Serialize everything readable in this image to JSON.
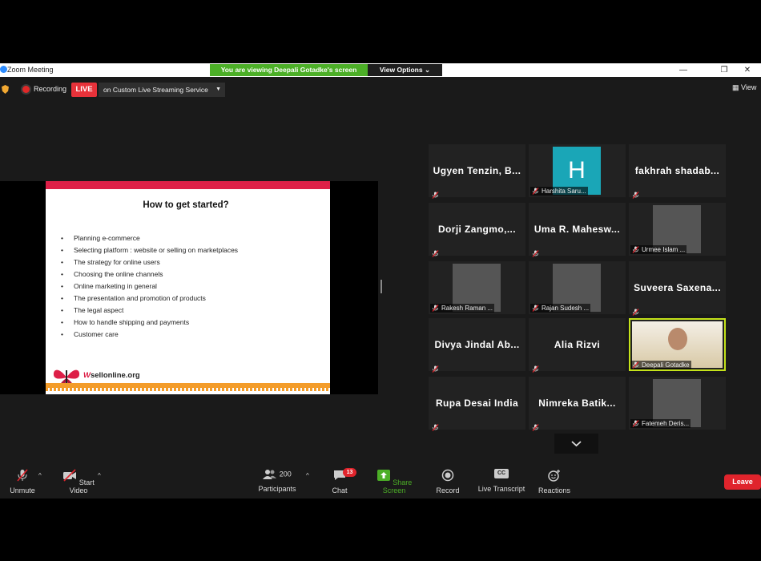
{
  "window": {
    "title": "Zoom Meeting",
    "banner": "You are viewing Deepali Gotadke's screen",
    "view_options": "View Options"
  },
  "meeting_bar": {
    "recording_label": "Recording",
    "live_badge": "LIVE",
    "stream_target": "on Custom Live Streaming Service",
    "view_label": "View"
  },
  "slide": {
    "title": "How to get started?",
    "bullets": [
      "Planning e-commerce",
      "Selecting platform : website or selling on marketplaces",
      "The strategy for online users",
      "Choosing the online channels",
      "Online marketing in general",
      "The presentation and promotion of products",
      "The legal aspect",
      "How to handle shipping and payments",
      "Customer care"
    ],
    "logo_text": "sellonline.org",
    "logo_prefix": "W",
    "colors": {
      "top_bar": "#dd1f47",
      "stripe": "#f39c2a"
    }
  },
  "participants": [
    {
      "name": "Ugyen Tenzin, B...",
      "video": false
    },
    {
      "name": "Harshita Saru...",
      "video": true,
      "avatar_letter": "H"
    },
    {
      "name": "fakhrah shadab...",
      "video": false
    },
    {
      "name": "Dorji Zangmo,...",
      "video": false
    },
    {
      "name": "Uma R. Mahesw...",
      "video": false
    },
    {
      "name": "Urmee Islam ...",
      "video": true
    },
    {
      "name": "Rakesh Raman ...",
      "video": true
    },
    {
      "name": "Rajan Sudesh ...",
      "video": true
    },
    {
      "name": "Suveera Saxena...",
      "video": false
    },
    {
      "name": "Divya Jindal Ab...",
      "video": false
    },
    {
      "name": "Alia Rizvi",
      "video": false
    },
    {
      "name": "Deepali Gotadke",
      "video": true,
      "active_speaker": true
    },
    {
      "name": "Rupa Desai India",
      "video": false
    },
    {
      "name": "Nimreka Batik...",
      "video": false
    },
    {
      "name": "Fatemeh Deris...",
      "video": true
    }
  ],
  "toolbar": {
    "unmute": "Unmute",
    "start_video": "Start Video",
    "participants": "Participants",
    "participants_count": "200",
    "chat": "Chat",
    "chat_badge": "13",
    "share_screen": "Share Screen",
    "record": "Record",
    "live_transcript": "Live Transcript",
    "live_transcript_icon": "CC",
    "reactions": "Reactions",
    "leave": "Leave"
  },
  "colors": {
    "share_green": "#4caf27",
    "live_red": "#e8323a",
    "leave_red": "#e0242c",
    "active_outline": "#c5e31a"
  }
}
